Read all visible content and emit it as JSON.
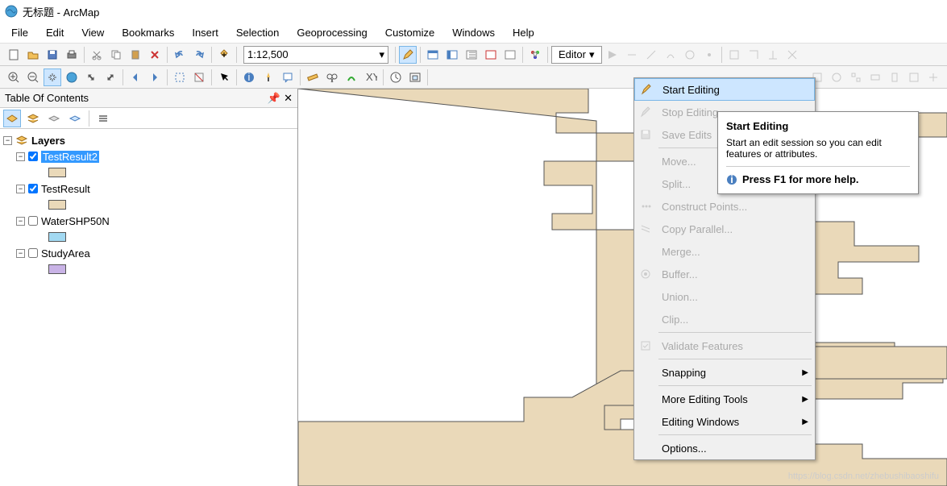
{
  "window": {
    "title": "无标题 - ArcMap"
  },
  "menubar": [
    "File",
    "Edit",
    "View",
    "Bookmarks",
    "Insert",
    "Selection",
    "Geoprocessing",
    "Customize",
    "Windows",
    "Help"
  ],
  "toolbar": {
    "scale": "1:12,500",
    "editor_label": "Editor"
  },
  "toc": {
    "title": "Table Of Contents",
    "root": "Layers",
    "layers": [
      {
        "name": "TestResult2",
        "checked": true,
        "selected": true,
        "swatch": "#ead9b9"
      },
      {
        "name": "TestResult",
        "checked": true,
        "selected": false,
        "swatch": "#ead9b9"
      },
      {
        "name": "WaterSHP50N",
        "checked": false,
        "selected": false,
        "swatch": "#a2d9f2"
      },
      {
        "name": "StudyArea",
        "checked": false,
        "selected": false,
        "swatch": "#c9b3e6"
      }
    ]
  },
  "editor_menu": [
    {
      "label": "Start Editing",
      "enabled": true,
      "highlighted": true,
      "icon": "pencil"
    },
    {
      "label": "Stop Editing",
      "enabled": false,
      "icon": "pencil-stop"
    },
    {
      "label": "Save Edits",
      "enabled": false,
      "icon": "save"
    },
    {
      "sep": true
    },
    {
      "label": "Move...",
      "enabled": false
    },
    {
      "label": "Split...",
      "enabled": false
    },
    {
      "label": "Construct Points...",
      "enabled": false,
      "icon": "points"
    },
    {
      "label": "Copy Parallel...",
      "enabled": false,
      "icon": "parallel"
    },
    {
      "label": "Merge...",
      "enabled": false
    },
    {
      "label": "Buffer...",
      "enabled": false,
      "icon": "buffer"
    },
    {
      "label": "Union...",
      "enabled": false
    },
    {
      "label": "Clip...",
      "enabled": false
    },
    {
      "sep": true
    },
    {
      "label": "Validate Features",
      "enabled": false,
      "icon": "validate"
    },
    {
      "sep": true
    },
    {
      "label": "Snapping",
      "enabled": true,
      "submenu": true
    },
    {
      "sep": true
    },
    {
      "label": "More Editing Tools",
      "enabled": true,
      "submenu": true
    },
    {
      "label": "Editing Windows",
      "enabled": true,
      "submenu": true
    },
    {
      "sep": true
    },
    {
      "label": "Options...",
      "enabled": true
    }
  ],
  "tooltip": {
    "title": "Start Editing",
    "body": "Start an edit session so you can edit features or attributes.",
    "help": "Press F1 for more help."
  },
  "watermark": "https://blog.csdn.net/zhebushibaoshifu"
}
